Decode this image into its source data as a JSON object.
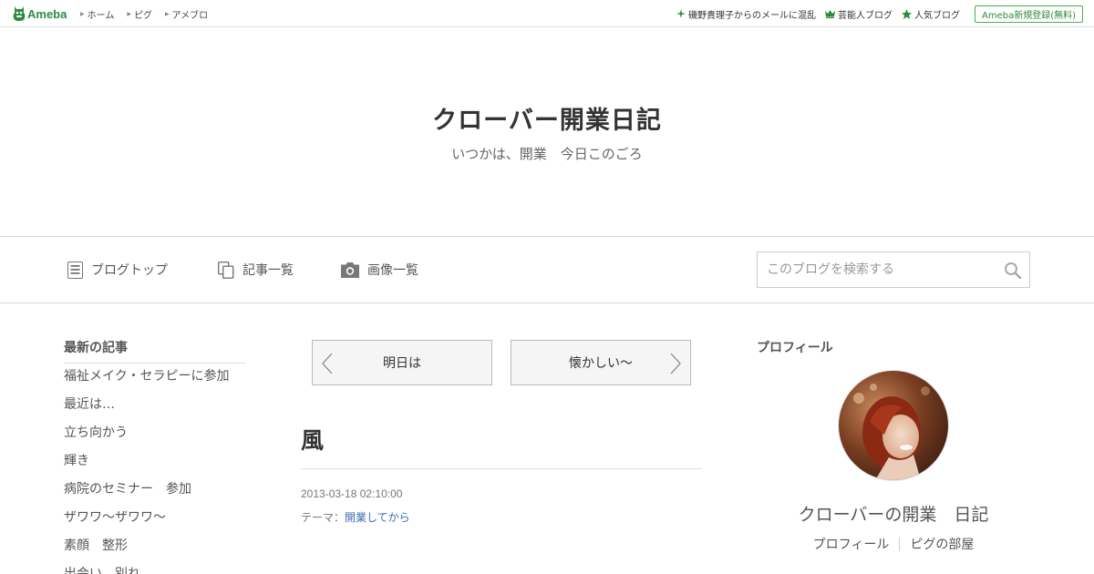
{
  "topbar": {
    "logo_text": "Ameba",
    "nav": [
      "ホーム",
      "ピグ",
      "アメブロ"
    ],
    "links": [
      {
        "label": "磯野貴理子からのメールに混乱",
        "icon": "sparkle-icon"
      },
      {
        "label": "芸能人ブログ",
        "icon": "crown-icon"
      },
      {
        "label": "人気ブログ",
        "icon": "star-icon"
      }
    ],
    "register_label": "Ameba新規登録(無料)"
  },
  "blog": {
    "title": "クローバー開業日記",
    "description": "いつかは、開業　今日このごろ"
  },
  "blognav": {
    "items": [
      {
        "label": "ブログトップ",
        "icon": "document-icon"
      },
      {
        "label": "記事一覧",
        "icon": "copy-icon"
      },
      {
        "label": "画像一覧",
        "icon": "camera-icon"
      }
    ],
    "search_placeholder": "このブログを検索する"
  },
  "sidebar": {
    "recent_heading": "最新の記事",
    "recent": [
      "福祉メイク・セラピーに参加",
      "最近は…",
      "立ち向かう",
      "輝き",
      "病院のセミナー　参加",
      "ザワワ～ザワワ～",
      "素顔　整形",
      "出会い　別れ"
    ]
  },
  "article": {
    "prev_label": "明日は",
    "next_label": "懐かしい～",
    "title": "風",
    "date": "2013-03-18 02:10:00",
    "theme_prefix": "テーマ：",
    "theme": "開業してから"
  },
  "profile": {
    "heading": "プロフィール",
    "name": "クローバーの開業　日記",
    "links": [
      "プロフィール",
      "ピグの部屋"
    ]
  },
  "colors": {
    "brand": "#2d8c3c",
    "link": "#3a6fb0",
    "border": "#d6d6d6"
  }
}
